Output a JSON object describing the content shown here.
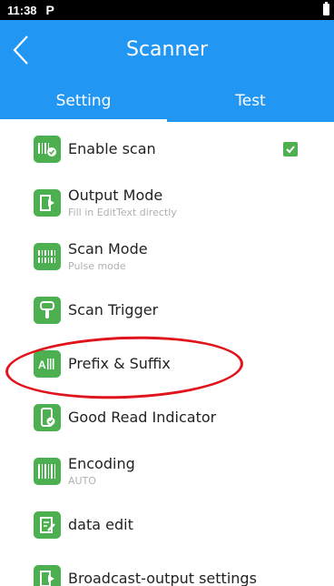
{
  "status_bar": {
    "time": "11:38",
    "notification": "P"
  },
  "app_bar": {
    "title": "Scanner"
  },
  "tabs": [
    {
      "label": "Setting",
      "active": true
    },
    {
      "label": "Test",
      "active": false
    }
  ],
  "colors": {
    "primary": "#2196f3",
    "icon_green": "#4caf50",
    "annotation_red": "#e0141c"
  },
  "settings": [
    {
      "title": "Enable scan",
      "subtitle": "",
      "icon": "barcode-check-icon",
      "checked": true
    },
    {
      "title": "Output Mode",
      "subtitle": "Fill in EditText directly",
      "icon": "output-arrow-icon"
    },
    {
      "title": "Scan Mode",
      "subtitle": "Pulse mode",
      "icon": "scan-mode-icon"
    },
    {
      "title": "Scan Trigger",
      "subtitle": "",
      "icon": "hand-trigger-icon"
    },
    {
      "title": "Prefix & Suffix",
      "subtitle": "",
      "icon": "prefix-suffix-icon"
    },
    {
      "title": "Good Read Indicator",
      "subtitle": "",
      "icon": "good-read-icon"
    },
    {
      "title": "Encoding",
      "subtitle": "AUTO",
      "icon": "encoding-icon"
    },
    {
      "title": "data edit",
      "subtitle": "",
      "icon": "data-edit-icon"
    },
    {
      "title": "Broadcast-output settings",
      "subtitle": "",
      "icon": "broadcast-icon"
    }
  ]
}
